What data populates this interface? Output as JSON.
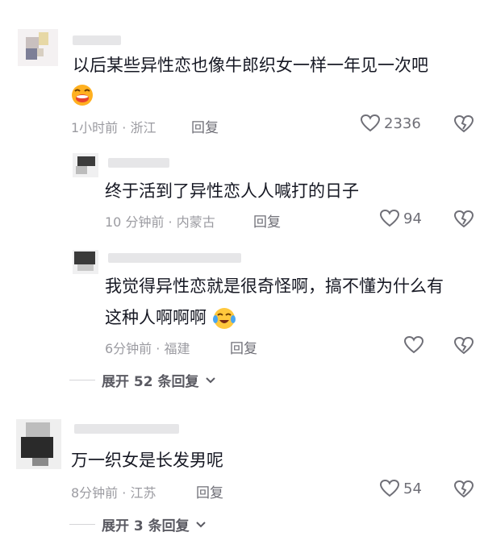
{
  "comments": [
    {
      "text_line1": "以后某些异性恋也像牛郎织女一样一年见一次吧",
      "emoji": "smiling-emoji",
      "time": "1小时前 · 浙江",
      "reply": "回复",
      "likes": "2336"
    },
    {
      "text": "终于活到了异性恋人人喊打的日子",
      "time": "10 分钟前 · 内蒙古",
      "reply": "回复",
      "likes": "94"
    },
    {
      "text_line1": "我觉得异性恋就是很奇怪啊，搞不懂为什么有",
      "text_line2": "这种人啊啊啊",
      "emoji": "crying-laughing-emoji",
      "time": "6分钟前 · 福建",
      "reply": "回复",
      "likes": ""
    },
    {
      "text": "万一织女是长发男呢",
      "time": "8分钟前 · 江苏",
      "reply": "回复",
      "likes": "54"
    }
  ],
  "expand_1": "展开 52 条回复",
  "expand_2": "展开 3 条回复",
  "colors": {
    "text": "#161823",
    "meta": "#9b9ba1",
    "icon": "#6f6f77"
  }
}
